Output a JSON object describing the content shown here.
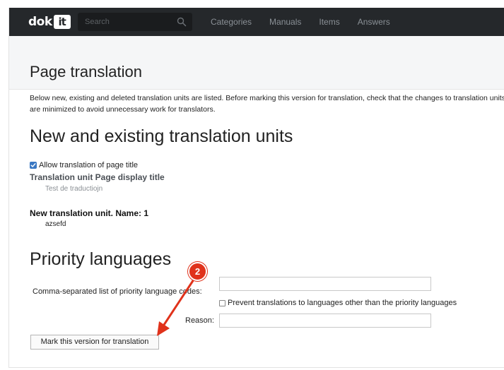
{
  "navbar": {
    "logo_text": "dok",
    "logo_box": "it",
    "search_placeholder": "Search",
    "links": [
      "Categories",
      "Manuals",
      "Items",
      "Answers"
    ]
  },
  "page": {
    "title": "Page translation",
    "intro": "Below new, existing and deleted translation units are listed. Before marking this version for translation, check that the changes to translation units are minimized to avoid unnecessary work for translators."
  },
  "units_section": {
    "heading": "New and existing translation units",
    "allow_label": "Allow translation of page title",
    "allow_checked": true,
    "unit1_title": "Translation unit Page display title",
    "unit1_value": "Test de traductiojn",
    "unit2_title": "New translation unit. Name: 1",
    "unit2_value": "azsefd"
  },
  "priority_section": {
    "heading": "Priority languages",
    "codes_label": "Comma-separated list of priority language codes:",
    "codes_value": "",
    "prevent_label": "Prevent translations to languages other than the priority languages",
    "prevent_checked": false,
    "reason_label": "Reason:",
    "reason_value": ""
  },
  "actions": {
    "mark_button": "Mark this version for translation"
  },
  "annotation": {
    "step_number": "2",
    "color": "#e0321b"
  },
  "colors": {
    "navbar_bg": "#25282b",
    "checkbox_accent": "#3a78c3"
  }
}
